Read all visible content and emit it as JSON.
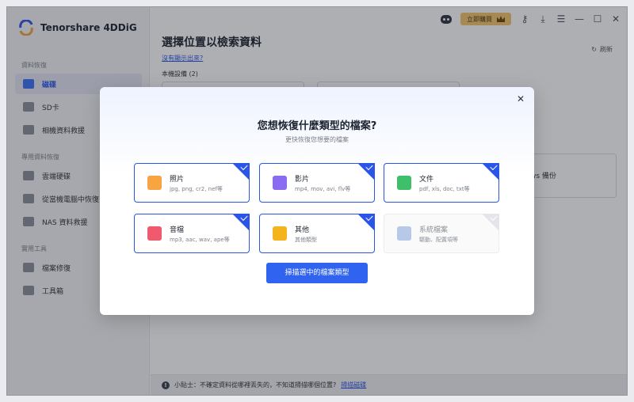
{
  "app": {
    "name": "Tenorshare 4DDiG"
  },
  "titlebar": {
    "buy_label": "立即購買"
  },
  "sidebar": {
    "sections": [
      {
        "title": "資料恢復",
        "items": [
          {
            "label": "磁碟",
            "icon": "drive-icon",
            "active": true
          },
          {
            "label": "SD卡",
            "icon": "sd-card-icon"
          },
          {
            "label": "相機資料救援",
            "icon": "camera-icon"
          }
        ]
      },
      {
        "title": "專用資料恢復",
        "items": [
          {
            "label": "雲端硬碟",
            "icon": "cloud-icon"
          },
          {
            "label": "從當機電腦中恢復",
            "icon": "crashed-pc-icon"
          },
          {
            "label": "NAS 資料救援",
            "icon": "nas-icon"
          }
        ]
      },
      {
        "title": "實用工具",
        "items": [
          {
            "label": "檔案修復",
            "icon": "file-repair-icon"
          },
          {
            "label": "工具箱",
            "icon": "toolbox-icon"
          }
        ]
      }
    ]
  },
  "main": {
    "title": "選擇位置以檢索資料",
    "help_link": "沒有顯示出來?",
    "refresh_label": "刷新",
    "local_label": "本機設備 (2)",
    "backup_label": "ws 備份"
  },
  "tip": {
    "prefix": "小貼士：不確定資料從哪裡丟失的，不知道掃描哪個位置?",
    "link": "掃描磁碟"
  },
  "dialog": {
    "title": "您想恢復什麼類型的檔案?",
    "subtitle": "更快恢復您想要的檔案",
    "cards": [
      {
        "name": "照片",
        "desc": "jpg, png, cr2, nef等",
        "color": "#f7a441",
        "selected": true
      },
      {
        "name": "影片",
        "desc": "mp4, mov, avi, flv等",
        "color": "#8b6cf0",
        "selected": true
      },
      {
        "name": "文件",
        "desc": "pdf, xls, doc, txt等",
        "color": "#3ec06a",
        "selected": true
      },
      {
        "name": "音檔",
        "desc": "mp3, aac, wav, ape等",
        "color": "#ef5a6f",
        "selected": true
      },
      {
        "name": "其他",
        "desc": "其他類型",
        "color": "#f5b31e",
        "selected": true
      },
      {
        "name": "系統檔案",
        "desc": "驅動、配置項等",
        "color": "#b8c8e8",
        "selected": false
      }
    ],
    "scan_button": "掃描選中的檔案類型"
  },
  "colors": {
    "accent": "#2f63f0",
    "buy": "#f3c46b"
  }
}
